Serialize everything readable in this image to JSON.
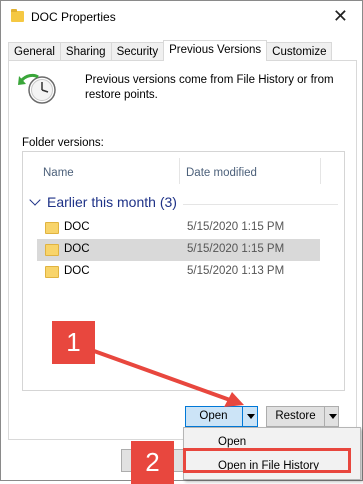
{
  "window": {
    "title": "DOC Properties",
    "close_glyph": "✕"
  },
  "tabs": [
    {
      "label": "General"
    },
    {
      "label": "Sharing"
    },
    {
      "label": "Security"
    },
    {
      "label": "Previous Versions"
    },
    {
      "label": "Customize"
    }
  ],
  "description": "Previous versions come from File History or from restore points.",
  "folder_versions_label": "Folder versions:",
  "columns": {
    "name": "Name",
    "date_modified": "Date modified"
  },
  "group": {
    "label": "Earlier this month (3)"
  },
  "rows": [
    {
      "name": "DOC",
      "date": "5/15/2020 1:15 PM"
    },
    {
      "name": "DOC",
      "date": "5/15/2020 1:15 PM"
    },
    {
      "name": "DOC",
      "date": "5/15/2020 1:13 PM"
    }
  ],
  "buttons": {
    "open": "Open",
    "restore": "Restore"
  },
  "menu": {
    "items": [
      {
        "label": "Open"
      },
      {
        "label": "Open in File History"
      }
    ]
  },
  "callouts": {
    "one": "1",
    "two": "2",
    "color": "#e8473e"
  },
  "colors": {
    "accent": "#0078d7",
    "group_header": "#1e3287",
    "selected_row": "#d9d9d9"
  }
}
